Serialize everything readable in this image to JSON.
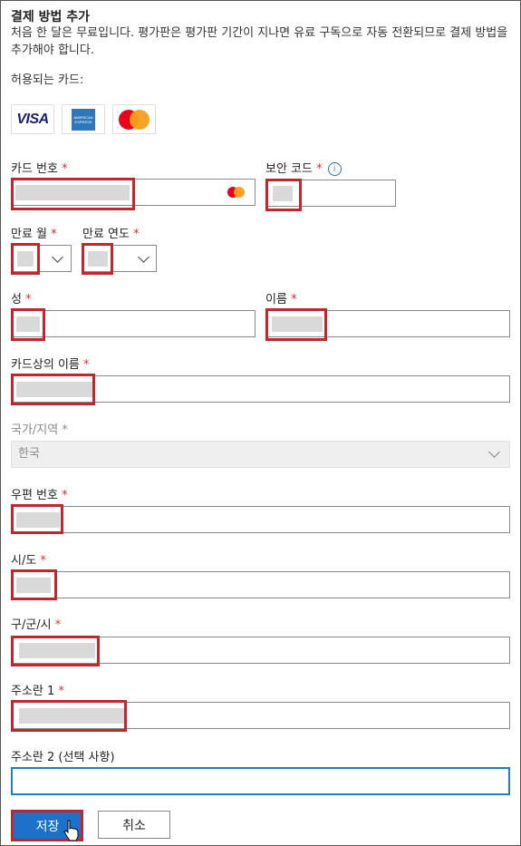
{
  "header": {
    "title": "결제 방법 추가",
    "description": "처음 한 달은 무료입니다. 평가판은 평가판 기간이 지나면 유료 구독으로 자동 전환되므로 결제 방법을 추가해야 합니다.",
    "allowed_cards_label": "허용되는 카드:"
  },
  "cards": {
    "visa": "VISA",
    "amex": "AMERICAN EXPRESS",
    "mastercard_icon": "mastercard-logo"
  },
  "fields": {
    "card_number": {
      "label": "카드 번호",
      "required": "*",
      "value": ""
    },
    "security_code": {
      "label": "보안 코드",
      "required": "*",
      "value": "",
      "info_glyph": "i"
    },
    "exp_month": {
      "label": "만료 월",
      "required": "*",
      "value": ""
    },
    "exp_year": {
      "label": "만료 연도",
      "required": "*",
      "value": ""
    },
    "last_name": {
      "label": "성",
      "required": "*",
      "value": ""
    },
    "first_name": {
      "label": "이름",
      "required": "*",
      "value": ""
    },
    "name_on_card": {
      "label": "카드상의 이름",
      "required": "*",
      "value": ""
    },
    "country": {
      "label": "국가/지역",
      "required": "*",
      "value": "한국"
    },
    "postal_code": {
      "label": "우편 번호",
      "required": "*",
      "value": ""
    },
    "state": {
      "label": "시/도",
      "required": "*",
      "value": ""
    },
    "city": {
      "label": "구/군/시",
      "required": "*",
      "value": ""
    },
    "address1": {
      "label": "주소란 1",
      "required": "*",
      "value": ""
    },
    "address2": {
      "label": "주소란 2 (선택 사항)",
      "value": ""
    }
  },
  "buttons": {
    "save": "저장",
    "cancel": "취소"
  },
  "colors": {
    "required": "#d13438",
    "highlight": "#c0272d",
    "primary": "#1b72c8",
    "focus_border": "#1e7fc1"
  }
}
